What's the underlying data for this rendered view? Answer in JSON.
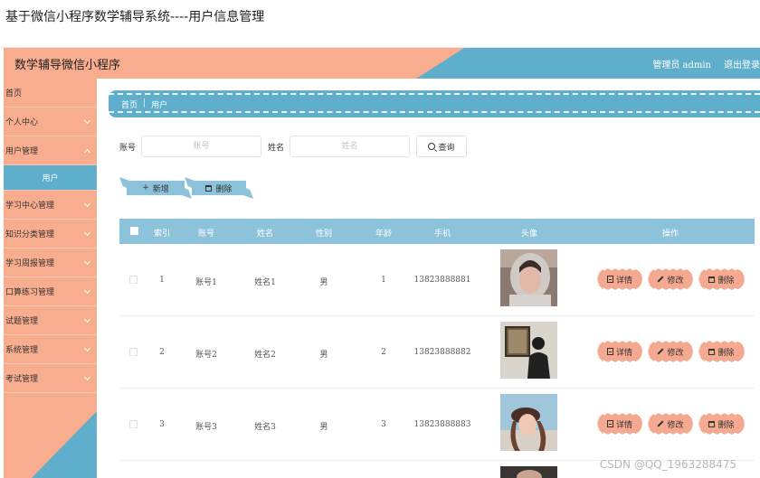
{
  "page_caption": "基于微信小程序数学辅导系统----用户信息管理",
  "header": {
    "app_title": "数学辅导微信小程序",
    "admin_label": "管理员 admin",
    "logout_label": "退出登录"
  },
  "sidebar": {
    "items": [
      {
        "label": "首页"
      },
      {
        "label": "个人中心"
      },
      {
        "label": "用户管理"
      },
      {
        "label": "用户"
      },
      {
        "label": "学习中心管理"
      },
      {
        "label": "知识分类管理"
      },
      {
        "label": "学习周报管理"
      },
      {
        "label": "口算练习管理"
      },
      {
        "label": "试题管理"
      },
      {
        "label": "系统管理"
      },
      {
        "label": "考试管理"
      }
    ]
  },
  "breadcrumb": {
    "home": "首页",
    "separator": "|",
    "current": "用户"
  },
  "search": {
    "account_label": "账号",
    "account_placeholder": "账号",
    "name_label": "姓名",
    "name_placeholder": "姓名",
    "query_button": "查询"
  },
  "toolbar": {
    "add_label": "新增",
    "delete_label": "删除"
  },
  "table": {
    "columns": [
      "索引",
      "账号",
      "姓名",
      "性别",
      "年龄",
      "手机",
      "头像",
      "操作"
    ],
    "rows": [
      {
        "index": "1",
        "account": "账号1",
        "name": "姓名1",
        "gender": "男",
        "age": "1",
        "phone": "13823888881"
      },
      {
        "index": "2",
        "account": "账号2",
        "name": "姓名2",
        "gender": "男",
        "age": "2",
        "phone": "13823888882"
      },
      {
        "index": "3",
        "account": "账号3",
        "name": "姓名3",
        "gender": "男",
        "age": "3",
        "phone": "13823888883"
      }
    ],
    "actions": {
      "detail": "详情",
      "edit": "修改",
      "delete": "删除"
    }
  },
  "watermark": "CSDN @QQ_1963288475",
  "colors": {
    "accent_orange": "#f8ad8f",
    "accent_blue": "#5faecb",
    "table_head": "#8cc3da",
    "action_button": "#f4a990"
  }
}
